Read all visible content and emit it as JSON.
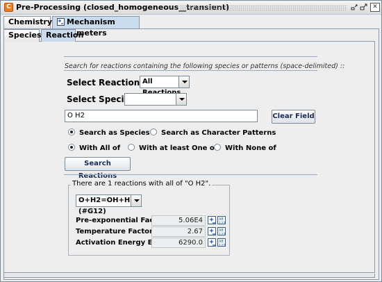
{
  "window": {
    "title": "Pre-Processing  (closed_homogeneous__transient)",
    "app_icon_glyph": "C",
    "controls": {
      "minimize": "▫",
      "maximize": "▫",
      "close": "✕"
    }
  },
  "main_tabs": [
    {
      "label": "Chemistry Set",
      "selected": false
    },
    {
      "label": "Mechanism Parameters",
      "selected": true
    }
  ],
  "sub_tabs": [
    {
      "label": "Species",
      "selected": false
    },
    {
      "label": "Reaction",
      "selected": true
    }
  ],
  "search": {
    "hint": "Search for reactions containing the following species or patterns (space-delimited) ::",
    "reaction_set_label": "Select Reaction Set :",
    "reaction_set_value": "All Reactions",
    "species_label": "Select Species :",
    "species_value": "",
    "query_value": "O H2",
    "clear_button": "Clear Field",
    "mode_options": [
      {
        "label": "Search as Species",
        "selected": true
      },
      {
        "label": "Search as Character Patterns",
        "selected": false
      }
    ],
    "match_options": [
      {
        "label": "With All of",
        "selected": true
      },
      {
        "label": "With at least One of",
        "selected": false
      },
      {
        "label": "With None of",
        "selected": false
      }
    ],
    "search_button": "Search Reactions"
  },
  "results": {
    "summary": "There are 1 reactions with all of \"O H2\".",
    "reaction_selected": "O+H2=OH+H (#G12)",
    "params": [
      {
        "label": "Pre-exponential Factor A",
        "value": "5.06E4"
      },
      {
        "label": "Temperature Factor B",
        "value": "2.67"
      },
      {
        "label": "Activation Energy E",
        "value": "6290.0"
      }
    ]
  },
  "colors": {
    "accent_tab": "#c8dced",
    "border": "#8a98a8",
    "app_icon": "#f07d1e",
    "divider": "#9aa8c6"
  }
}
